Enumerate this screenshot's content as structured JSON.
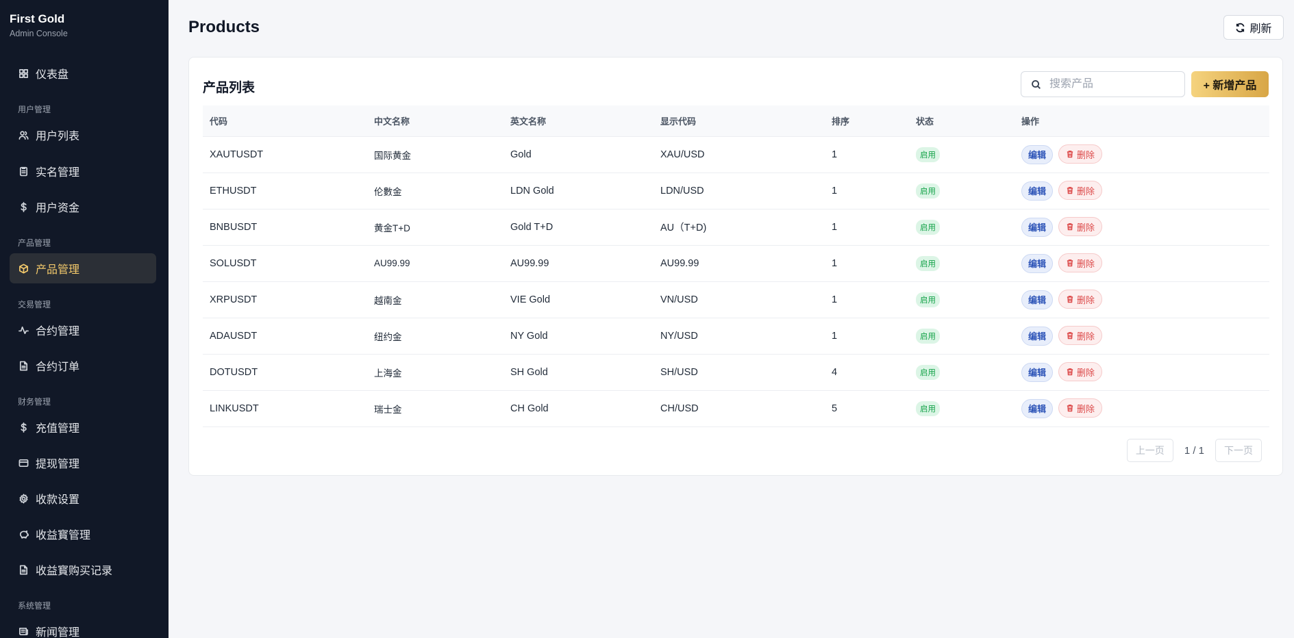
{
  "brand": {
    "title": "First Gold",
    "subtitle": "Admin Console"
  },
  "sidebar": {
    "items": [
      {
        "label": "仪表盘",
        "icon": "dashboard-icon"
      },
      {
        "group": "用户管理"
      },
      {
        "label": "用户列表",
        "icon": "users-icon"
      },
      {
        "label": "实名管理",
        "icon": "id-card-icon"
      },
      {
        "label": "用户资金",
        "icon": "dollar-icon"
      },
      {
        "group": "产品管理"
      },
      {
        "label": "产品管理",
        "icon": "box-icon",
        "active": true
      },
      {
        "group": "交易管理"
      },
      {
        "label": "合约管理",
        "icon": "activity-icon"
      },
      {
        "label": "合约订单",
        "icon": "file-icon"
      },
      {
        "group": "财务管理"
      },
      {
        "label": "充值管理",
        "icon": "dollar-icon"
      },
      {
        "label": "提现管理",
        "icon": "credit-card-icon"
      },
      {
        "label": "收款设置",
        "icon": "gear-icon"
      },
      {
        "label": "收益寳管理",
        "icon": "piggy-bank-icon"
      },
      {
        "label": "收益寳购买记录",
        "icon": "file-icon"
      },
      {
        "group": "系统管理"
      },
      {
        "label": "新闻管理",
        "icon": "news-icon"
      }
    ]
  },
  "header": {
    "title": "Products",
    "refresh_label": "刷新"
  },
  "card": {
    "title": "产品列表",
    "search_placeholder": "搜索产品",
    "add_label": "+ 新增产品"
  },
  "table": {
    "columns": [
      "代码",
      "中文名称",
      "英文名称",
      "显示代码",
      "排序",
      "状态",
      "操作"
    ],
    "rows": [
      {
        "code": "XAUTUSDT",
        "cn": "国际黄金",
        "en": "Gold",
        "display": "XAU/USD",
        "sort": "1",
        "status": "启用"
      },
      {
        "code": "ETHUSDT",
        "cn": "伦數金",
        "en": "LDN Gold",
        "display": "LDN/USD",
        "sort": "1",
        "status": "启用"
      },
      {
        "code": "BNBUSDT",
        "cn": "黄金T+D",
        "en": "Gold T+D",
        "display": "AU（T+D)",
        "sort": "1",
        "status": "启用"
      },
      {
        "code": "SOLUSDT",
        "cn": "AU99.99",
        "en": "AU99.99",
        "display": "AU99.99",
        "sort": "1",
        "status": "启用"
      },
      {
        "code": "XRPUSDT",
        "cn": "越南金",
        "en": "VIE Gold",
        "display": "VN/USD",
        "sort": "1",
        "status": "启用"
      },
      {
        "code": "ADAUSDT",
        "cn": "纽约金",
        "en": "NY Gold",
        "display": "NY/USD",
        "sort": "1",
        "status": "启用"
      },
      {
        "code": "DOTUSDT",
        "cn": "上海金",
        "en": "SH Gold",
        "display": "SH/USD",
        "sort": "4",
        "status": "启用"
      },
      {
        "code": "LINKUSDT",
        "cn": "瑞士金",
        "en": "CH Gold",
        "display": "CH/USD",
        "sort": "5",
        "status": "启用"
      }
    ],
    "edit_label": "编辑",
    "delete_label": "删除"
  },
  "pager": {
    "prev_label": "上一页",
    "info": "1 / 1",
    "next_label": "下一页"
  },
  "colors": {
    "sidebar_bg": "#111827",
    "accent": "#f3c96b",
    "status_green": "#16a34a",
    "danger": "#dc4a4a",
    "edit_blue": "#2e55b8"
  }
}
